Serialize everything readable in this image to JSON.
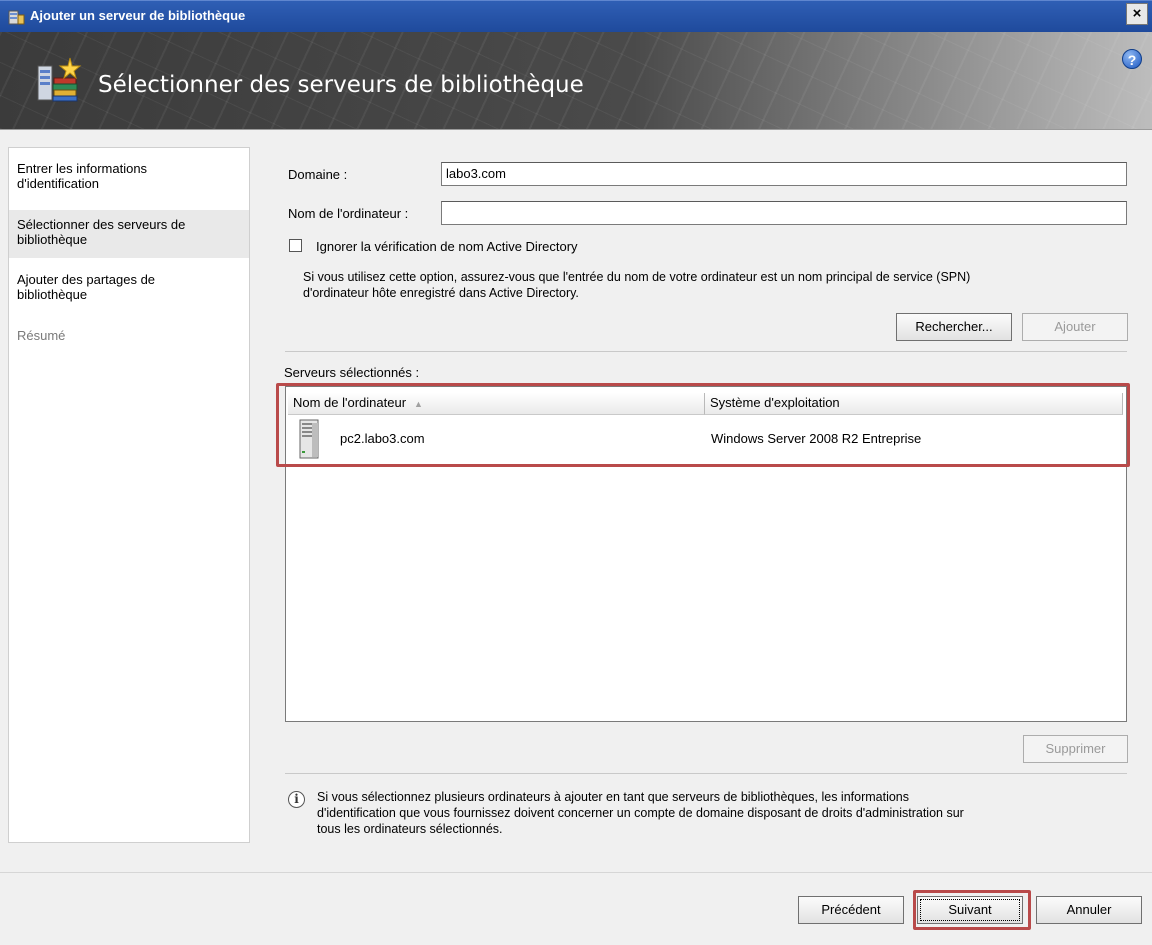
{
  "window": {
    "title": "Ajouter un serveur de bibliothèque",
    "close_label": "×"
  },
  "header": {
    "title": "Sélectionner des serveurs de bibliothèque",
    "help_label": "?"
  },
  "nav": {
    "items": [
      {
        "line1": "Entrer les informations",
        "line2": "d'identification"
      },
      {
        "line1": "Sélectionner des serveurs de",
        "line2": "bibliothèque"
      },
      {
        "line1": "Ajouter des partages de",
        "line2": "bibliothèque"
      },
      {
        "line1": "Résumé",
        "line2": ""
      }
    ]
  },
  "form": {
    "domain_label": "Domaine :",
    "domain_value": "labo3.com",
    "computer_label": "Nom de l'ordinateur :",
    "computer_value": "",
    "ignore_ad_label": "Ignorer la vérification de nom Active Directory",
    "ignore_ad_help_line1": "Si vous utilisez cette option, assurez-vous que l'entrée du nom de votre ordinateur est un nom principal de service (SPN)",
    "ignore_ad_help_line2": "d'ordinateur hôte enregistré dans Active Directory.",
    "search_button": "Rechercher...",
    "add_button": "Ajouter"
  },
  "selected": {
    "label": "Serveurs sélectionnés :",
    "columns": [
      "Nom de l'ordinateur",
      "Système d'exploitation"
    ],
    "sort_indicator": "▲",
    "rows": [
      {
        "computer": "pc2.labo3.com",
        "os": "Windows Server 2008 R2 Entreprise"
      }
    ],
    "remove_button": "Supprimer"
  },
  "info": {
    "icon_label": "i",
    "line1": "Si vous sélectionnez plusieurs ordinateurs à ajouter en tant que serveurs de bibliothèques, les informations",
    "line2": "d'identification que vous fournissez doivent concerner un compte de domaine disposant de droits d'administration sur",
    "line3": "tous les ordinateurs sélectionnés."
  },
  "footer": {
    "previous_button": "Précédent",
    "next_button": "Suivant",
    "cancel_button": "Annuler"
  },
  "colors": {
    "highlight": "#b94a4a",
    "titlebar": "#2f5fb5"
  }
}
